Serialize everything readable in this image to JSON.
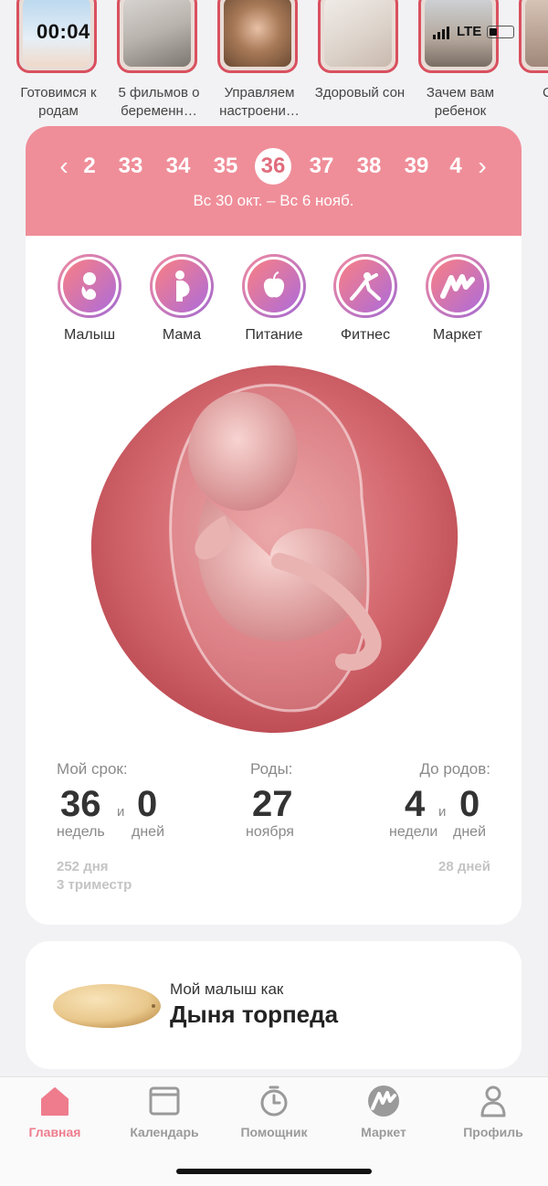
{
  "stories": [
    {
      "label": "Готовимся к родам"
    },
    {
      "label": "5 фильмов о беременн…"
    },
    {
      "label": "Управляем настроени…"
    },
    {
      "label": "Здоровый сон"
    },
    {
      "label": "Зачем вам ребенок"
    },
    {
      "label": "С"
    }
  ],
  "status": {
    "timer": "00:04",
    "network": "LTE"
  },
  "week_nav": {
    "prev_icon": "chevron-left-icon",
    "next_icon": "chevron-right-icon",
    "weeks": [
      "2",
      "33",
      "34",
      "35",
      "36",
      "37",
      "38",
      "39",
      "4"
    ],
    "active_week": "36",
    "range": "Вс 30 окт. – Вс 6 нояб."
  },
  "categories": [
    {
      "label": "Малыш",
      "icon": "baby-icon"
    },
    {
      "label": "Мама",
      "icon": "pregnant-mother-icon"
    },
    {
      "label": "Питание",
      "icon": "apple-icon"
    },
    {
      "label": "Фитнес",
      "icon": "fitness-icon"
    },
    {
      "label": "Маркет",
      "icon": "market-logo-icon"
    }
  ],
  "stats": {
    "term": {
      "heading": "Мой срок:",
      "weeks": "36",
      "and": "и",
      "days": "0",
      "weeks_unit": "недель",
      "days_unit": "дней",
      "total_days": "252 дня",
      "trimester": "3 триместр"
    },
    "birth": {
      "heading": "Роды:",
      "day": "27",
      "month": "ноября"
    },
    "until": {
      "heading": "До родов:",
      "weeks": "4",
      "and": "и",
      "days": "0",
      "weeks_unit": "недели",
      "days_unit": "дней",
      "total_days": "28 дней"
    }
  },
  "baby_size": {
    "prefix": "Мой малыш как",
    "name": "Дыня торпеда"
  },
  "tabs": [
    {
      "label": "Главная",
      "icon": "home-icon",
      "active": true
    },
    {
      "label": "Календарь",
      "icon": "calendar-icon",
      "active": false
    },
    {
      "label": "Помощник",
      "icon": "stopwatch-icon",
      "active": false
    },
    {
      "label": "Маркет",
      "icon": "market-logo-icon",
      "active": false
    },
    {
      "label": "Профиль",
      "icon": "profile-icon",
      "active": false
    }
  ],
  "colors": {
    "accent": "#ef8e99",
    "accent_dark": "#e06c7c",
    "tab_active": "#ee7c8d",
    "story_border": "#d9505f"
  }
}
